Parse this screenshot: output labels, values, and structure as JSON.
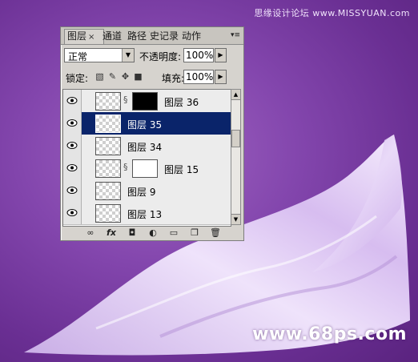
{
  "watermarks": {
    "top": "思缘设计论坛 www.MISSYUAN.com",
    "bottom": "www.68ps.com"
  },
  "panel": {
    "tabs": [
      {
        "label": "图层",
        "active": true
      },
      {
        "label": "通道",
        "active": false
      },
      {
        "label": "路径",
        "active": false
      },
      {
        "label": "历史记录",
        "active": false
      },
      {
        "label": "动作",
        "active": false
      }
    ],
    "tab_close": "×",
    "menu_glyph": "▾≡",
    "blend_mode": "正常",
    "opacity_label": "不透明度:",
    "opacity_value": "100%",
    "lock_label": "锁定:",
    "lock_icons": [
      "transparency-lock-icon",
      "brush-lock-icon",
      "move-lock-icon",
      "padlock-icon"
    ],
    "fill_label": "填充:",
    "fill_value": "100%",
    "layers": [
      {
        "name": "图层 36",
        "visible": true,
        "has_mask": true,
        "mask": "black",
        "selected": false
      },
      {
        "name": "图层 35",
        "visible": true,
        "has_mask": false,
        "selected": true
      },
      {
        "name": "图层 34",
        "visible": true,
        "has_mask": false,
        "selected": false
      },
      {
        "name": "图层 15",
        "visible": true,
        "has_mask": true,
        "mask": "white",
        "selected": false
      },
      {
        "name": "图层 9",
        "visible": true,
        "has_mask": false,
        "selected": false
      },
      {
        "name": "图层 13",
        "visible": true,
        "has_mask": false,
        "selected": false
      }
    ],
    "bottom_icons": [
      "link-icon",
      "fx-icon",
      "add-mask-icon",
      "adjustment-icon",
      "group-folder-icon",
      "new-layer-icon",
      "trash-icon"
    ],
    "bottom_glyphs": {
      "link": "∞",
      "fx": "fx",
      "mask": "◘",
      "adjust": "◐",
      "folder": "▭",
      "new": "❐",
      "trash": "🗑"
    },
    "colors": {
      "selection": "#0a246a",
      "panel": "#d6d3ce"
    }
  }
}
